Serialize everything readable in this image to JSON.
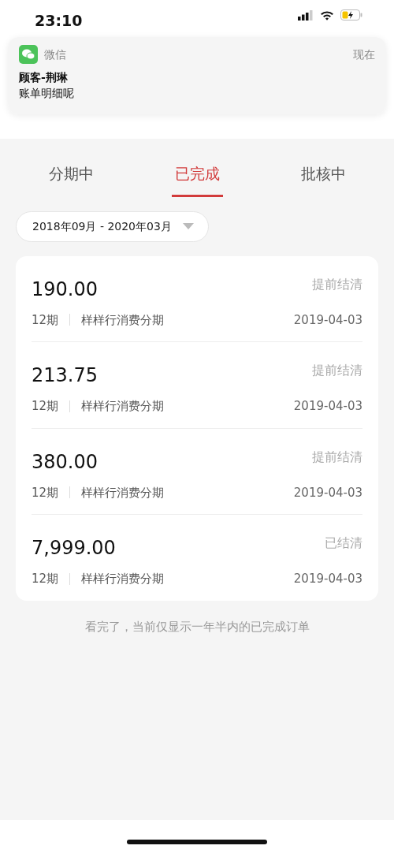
{
  "status_bar": {
    "time": "23:10"
  },
  "notification": {
    "app": "微信",
    "time": "现在",
    "title": "顾客-荆琳",
    "message": "账单明细呢"
  },
  "tabs": [
    {
      "label": "分期中",
      "selected": false
    },
    {
      "label": "已完成",
      "selected": true
    },
    {
      "label": "批核中",
      "selected": false
    }
  ],
  "date_filter": {
    "value": "2018年09月 - 2020年03月"
  },
  "orders": [
    {
      "amount": "190.00",
      "term": "12期",
      "type": "样样行消费分期",
      "status": "提前结清",
      "date": "2019-04-03"
    },
    {
      "amount": "213.75",
      "term": "12期",
      "type": "样样行消费分期",
      "status": "提前结清",
      "date": "2019-04-03"
    },
    {
      "amount": "380.00",
      "term": "12期",
      "type": "样样行消费分期",
      "status": "提前结清",
      "date": "2019-04-03"
    },
    {
      "amount": "7,999.00",
      "term": "12期",
      "type": "样样行消费分期",
      "status": "已结清",
      "date": "2019-04-03"
    }
  ],
  "footer_note": "看完了，当前仅显示一年半内的已完成订单"
}
